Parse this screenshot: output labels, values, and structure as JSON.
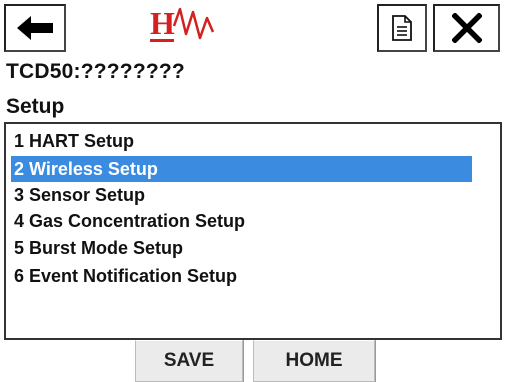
{
  "toolbar": {
    "back_icon": "back-arrow-icon",
    "logo_letter": "H",
    "document_icon": "document-icon",
    "close_icon": "close-icon"
  },
  "header": {
    "device_tag": "TCD50:????????",
    "menu_title": "Setup"
  },
  "menu": {
    "items": [
      {
        "label": "1 HART Setup",
        "selected": false
      },
      {
        "label": "2 Wireless Setup",
        "selected": true
      },
      {
        "label": "3 Sensor Setup",
        "selected": false
      },
      {
        "label": "4 Gas Concentration Setup",
        "selected": false
      },
      {
        "label": "5 Burst Mode Setup",
        "selected": false
      },
      {
        "label": "6 Event Notification Setup",
        "selected": false
      }
    ]
  },
  "buttons": {
    "save_label": "SAVE",
    "home_label": "HOME"
  },
  "colors": {
    "selection_bg": "#3b8be0",
    "logo_red": "#d42020"
  }
}
